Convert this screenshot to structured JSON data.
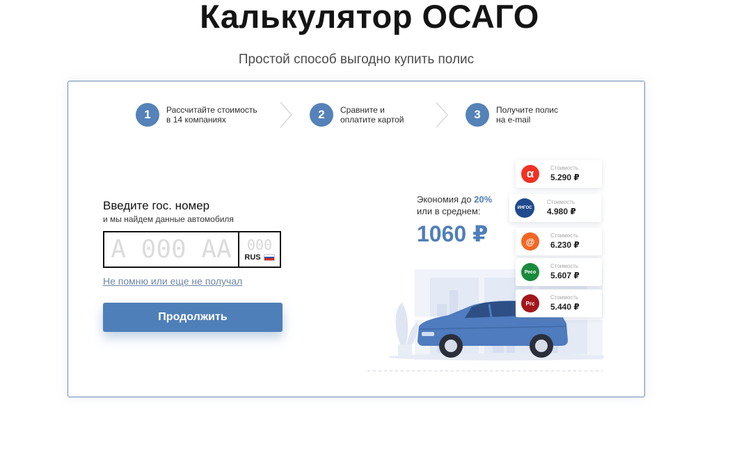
{
  "header": {
    "title": "Калькулятор ОСАГО",
    "subtitle": "Простой способ выгодно купить полис"
  },
  "steps": [
    {
      "number": "1",
      "text": "Рассчитайте стоимость\nв 14 компаниях"
    },
    {
      "number": "2",
      "text": "Сравните и\nоплатите картой"
    },
    {
      "number": "3",
      "text": "Получите полис\nна e-mail"
    }
  ],
  "form": {
    "title": "Введите гос. номер",
    "subtitle": "и мы найдем данные автомобиля",
    "plate_placeholder": "А 000 АА",
    "region_placeholder": "000",
    "country": "RUS",
    "forgot_link": "Не помню или еще не получал",
    "continue_label": "Продолжить"
  },
  "savings": {
    "prefix": "Экономия до ",
    "percent": "20%",
    "line2": "или в среднем:",
    "amount": "1060 ₽"
  },
  "insurers": [
    {
      "logo_text": "α",
      "label": "Стоимость",
      "price": "5.290 ₽",
      "color": "#ef3124"
    },
    {
      "logo_text": "ИНГОС",
      "label": "Стоимость",
      "price": "4.980 ₽",
      "color": "#1f4a8c"
    },
    {
      "logo_text": "@",
      "label": "Стоимость",
      "price": "6.230 ₽",
      "color": "#f26722"
    },
    {
      "logo_text": "Ресо",
      "label": "Стоимость",
      "price": "5.607 ₽",
      "color": "#1a8a3c"
    },
    {
      "logo_text": "Ргс",
      "label": "Стоимость",
      "price": "5.440 ₽",
      "color": "#a3161b"
    }
  ],
  "colors": {
    "accent": "#4f7fb8",
    "step_circle": "#5582b8",
    "card_border": "#6a8ab3"
  }
}
